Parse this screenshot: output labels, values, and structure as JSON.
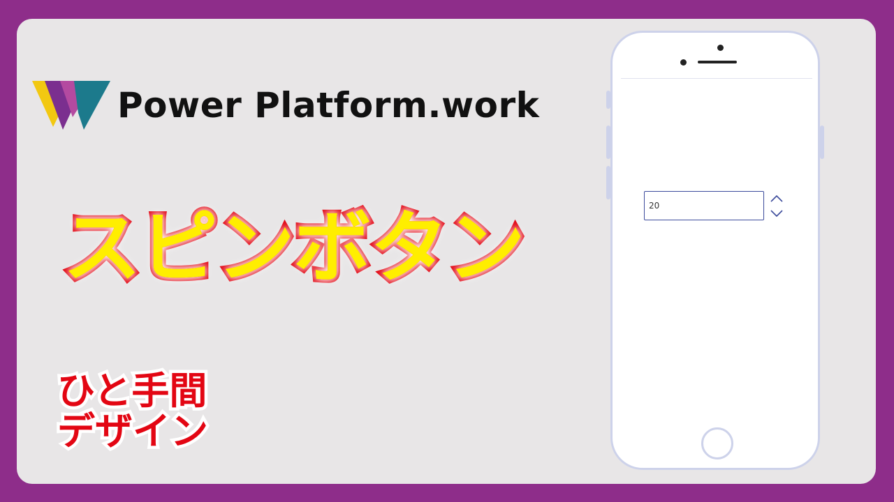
{
  "brand": {
    "name": "Power Platform.work",
    "logo_icon": "power-platform-w-logo"
  },
  "title": "スピンボタン",
  "subtitle": {
    "line1": "ひと手間",
    "line2": "デザイン"
  },
  "phone": {
    "spin_input": {
      "value": "20"
    },
    "spin_up_icon": "chevron-up-icon",
    "spin_down_icon": "chevron-down-icon"
  },
  "colors": {
    "background": "#8e2d8a",
    "card": "#e8e6e7",
    "title_fill": "#ffee00",
    "title_stroke": "#e30613",
    "subtitle_fill": "#e30613",
    "phone_border": "#cdd2ea",
    "input_border": "#3b4a9b"
  }
}
